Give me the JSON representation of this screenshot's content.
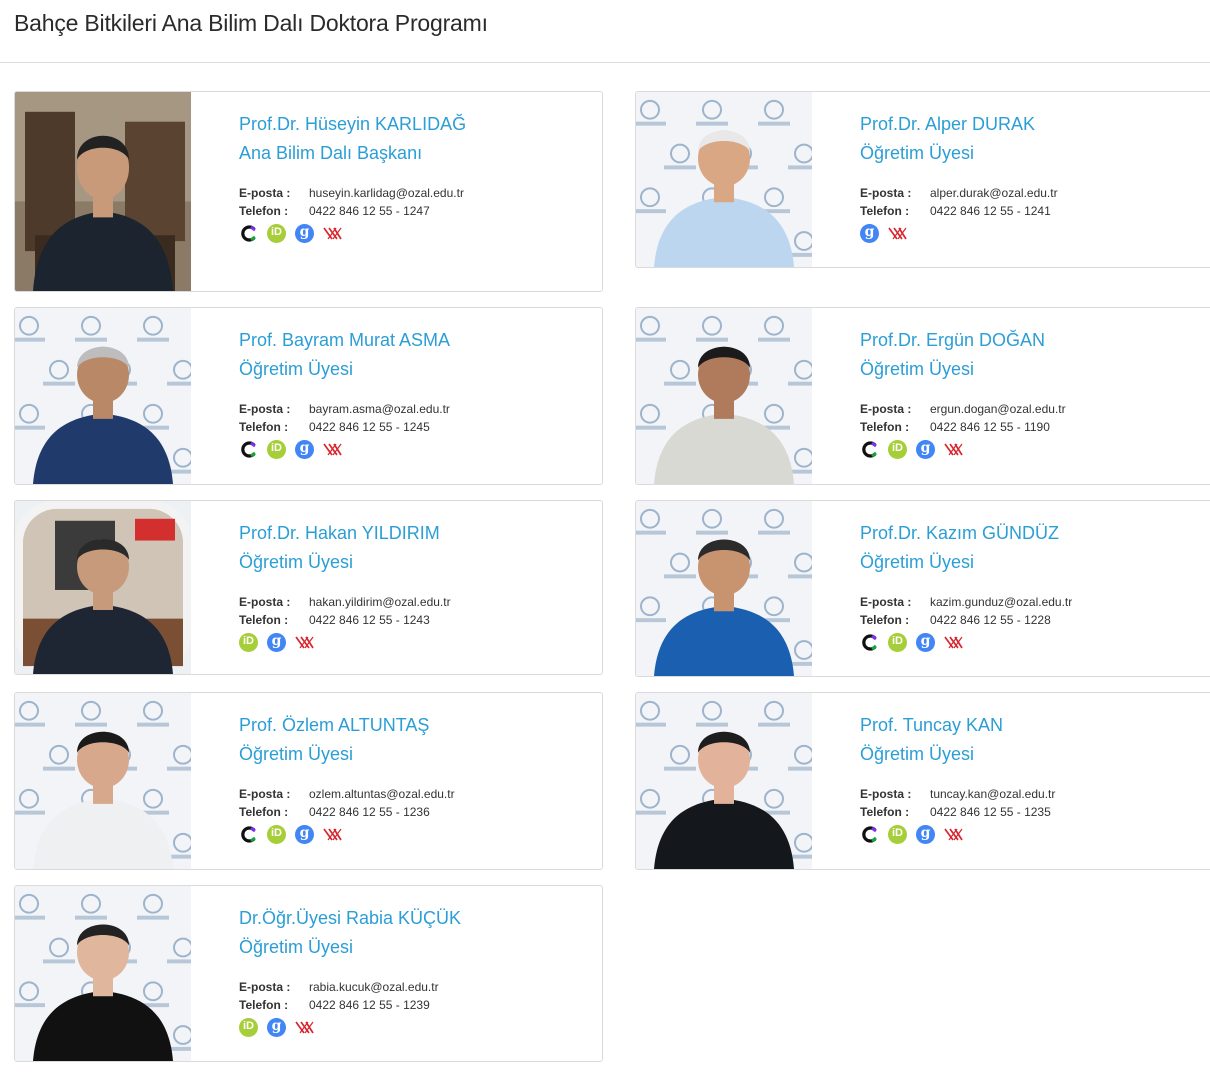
{
  "page": {
    "title": "Bahçe Bitkileri Ana Bilim Dalı Doktora Programı"
  },
  "labels": {
    "email": "E-posta :",
    "phone": "Telefon :"
  },
  "icons": {
    "scopus": "scopus-icon",
    "orcid": "orcid-icon",
    "scholar": "google-scholar-icon",
    "yok": "yoksis-icon",
    "orcid_text": "iD",
    "scholar_text": "g"
  },
  "colors": {
    "link": "#2b9ed6",
    "orcid": "#a6ce39",
    "scholar": "#4285f4",
    "yok": "#d7262e"
  },
  "people": [
    {
      "name": "Prof.Dr. Hüseyin KARLIDAĞ",
      "role": "Ana Bilim Dalı Başkanı",
      "email": "huseyin.karlidag@ozal.edu.tr",
      "phone": "0422 846 12 55 - 1247",
      "links": [
        "scopus",
        "orcid",
        "scholar",
        "yok"
      ]
    },
    {
      "name": "Prof.Dr. Alper DURAK",
      "role": "Öğretim Üyesi",
      "email": "alper.durak@ozal.edu.tr",
      "phone": "0422 846 12 55 - 1241",
      "links": [
        "scholar",
        "yok"
      ]
    },
    {
      "name": "Prof. Bayram Murat ASMA",
      "role": "Öğretim Üyesi",
      "email": "bayram.asma@ozal.edu.tr",
      "phone": "0422 846 12 55 - 1245",
      "links": [
        "scopus",
        "orcid",
        "scholar",
        "yok"
      ]
    },
    {
      "name": "Prof.Dr. Ergün DOĞAN",
      "role": "Öğretim Üyesi",
      "email": "ergun.dogan@ozal.edu.tr",
      "phone": "0422 846 12 55 - 1190",
      "links": [
        "scopus",
        "orcid",
        "scholar",
        "yok"
      ]
    },
    {
      "name": "Prof.Dr. Hakan YILDIRIM",
      "role": "Öğretim Üyesi",
      "email": "hakan.yildirim@ozal.edu.tr",
      "phone": "0422 846 12 55 - 1243",
      "links": [
        "orcid",
        "scholar",
        "yok"
      ]
    },
    {
      "name": "Prof.Dr. Kazım GÜNDÜZ",
      "role": "Öğretim Üyesi",
      "email": "kazim.gunduz@ozal.edu.tr",
      "phone": "0422 846 12 55 - 1228",
      "links": [
        "scopus",
        "orcid",
        "scholar",
        "yok"
      ]
    },
    {
      "name": "Prof. Özlem ALTUNTAŞ",
      "role": "Öğretim Üyesi",
      "email": "ozlem.altuntas@ozal.edu.tr",
      "phone": "0422 846 12 55 - 1236",
      "links": [
        "scopus",
        "orcid",
        "scholar",
        "yok"
      ]
    },
    {
      "name": "Prof. Tuncay KAN",
      "role": "Öğretim Üyesi",
      "email": "tuncay.kan@ozal.edu.tr",
      "phone": "0422 846 12 55 - 1235",
      "links": [
        "scopus",
        "orcid",
        "scholar",
        "yok"
      ]
    },
    {
      "name": "Dr.Öğr.Üyesi Rabia KÜÇÜK",
      "role": "Öğretim Üyesi",
      "email": "rabia.kucuk@ozal.edu.tr",
      "phone": "0422 846 12 55 - 1239",
      "links": [
        "orcid",
        "scholar",
        "yok"
      ]
    }
  ]
}
